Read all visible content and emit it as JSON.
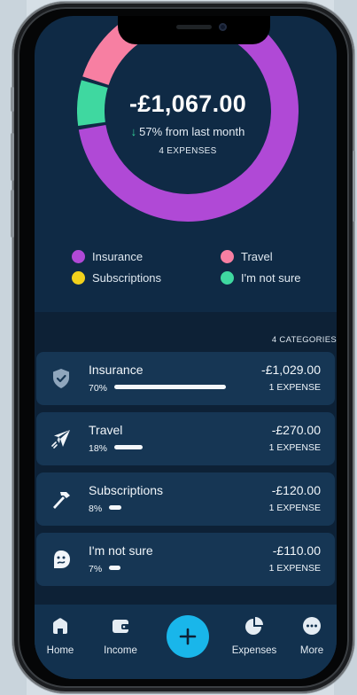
{
  "summary": {
    "total": "-£1,067.00",
    "change_text": "57% from last month",
    "expense_count": "4 EXPENSES"
  },
  "chart_data": {
    "type": "pie",
    "categories": [
      "Insurance",
      "Travel",
      "Subscriptions",
      "I'm not sure"
    ],
    "values": [
      1029,
      270,
      120,
      110
    ],
    "colors": [
      "#b049d6",
      "#f77fa2",
      "#f2d11c",
      "#3fd8a0"
    ]
  },
  "legend": [
    {
      "label": "Insurance",
      "color": "#b049d6"
    },
    {
      "label": "Travel",
      "color": "#f77fa2"
    },
    {
      "label": "Subscriptions",
      "color": "#f2d11c"
    },
    {
      "label": "I'm not sure",
      "color": "#3fd8a0"
    }
  ],
  "categories_header": "4 CATEGORIES",
  "categories": [
    {
      "name": "Insurance",
      "percent": "70%",
      "fraction": 0.7,
      "amount": "-£1,029.00",
      "count": "1 EXPENSE",
      "icon": "shield-check-icon"
    },
    {
      "name": "Travel",
      "percent": "18%",
      "fraction": 0.18,
      "amount": "-£270.00",
      "count": "1 EXPENSE",
      "icon": "paper-plane-icon"
    },
    {
      "name": "Subscriptions",
      "percent": "8%",
      "fraction": 0.08,
      "amount": "-£120.00",
      "count": "1 EXPENSE",
      "icon": "hammer-icon"
    },
    {
      "name": "I'm not sure",
      "percent": "7%",
      "fraction": 0.07,
      "amount": "-£110.00",
      "count": "1 EXPENSE",
      "icon": "confused-face-icon"
    }
  ],
  "tabs": [
    {
      "label": "Home",
      "icon": "home-icon"
    },
    {
      "label": "Income",
      "icon": "wallet-icon"
    },
    {
      "label": "Expenses",
      "icon": "pie-chart-icon"
    },
    {
      "label": "More",
      "icon": "more-dots-icon"
    }
  ],
  "colors": {
    "screen_bg": "#0f2a45",
    "card_bg": "#163654",
    "accent": "#19b6ea",
    "positive_arrow": "#34d39a"
  }
}
